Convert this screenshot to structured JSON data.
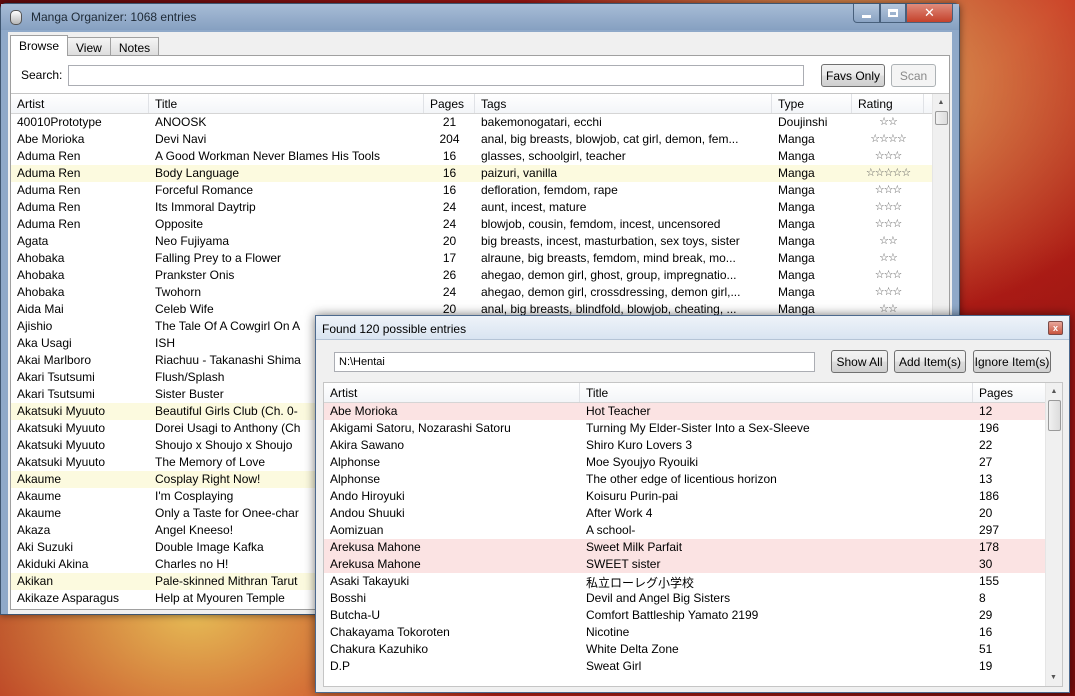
{
  "main_window": {
    "title": "Manga Organizer: 1068 entries",
    "tabs": [
      {
        "label": "Browse",
        "active": true
      },
      {
        "label": "View",
        "active": false
      },
      {
        "label": "Notes",
        "active": false
      }
    ],
    "search": {
      "label": "Search:",
      "value": ""
    },
    "buttons": {
      "favs_only": "Favs Only",
      "scan": "Scan"
    },
    "table": {
      "columns": [
        "Artist",
        "Title",
        "Pages",
        "Tags",
        "Type",
        "Rating"
      ],
      "rows": [
        {
          "artist": "40010Prototype",
          "title": "ANOOSK",
          "pages": "21",
          "tags": "bakemonogatari, ecchi",
          "type": "Doujinshi",
          "rating": "☆☆",
          "highlight": false
        },
        {
          "artist": "Abe Morioka",
          "title": "Devi Navi",
          "pages": "204",
          "tags": "anal, big breasts, blowjob, cat girl, demon, fem...",
          "type": "Manga",
          "rating": "☆☆☆☆",
          "highlight": false
        },
        {
          "artist": "Aduma Ren",
          "title": "A Good Workman Never Blames His Tools",
          "pages": "16",
          "tags": "glasses, schoolgirl, teacher",
          "type": "Manga",
          "rating": "☆☆☆",
          "highlight": false
        },
        {
          "artist": "Aduma Ren",
          "title": "Body Language",
          "pages": "16",
          "tags": "paizuri, vanilla",
          "type": "Manga",
          "rating": "☆☆☆☆☆",
          "highlight": true
        },
        {
          "artist": "Aduma Ren",
          "title": "Forceful Romance",
          "pages": "16",
          "tags": "defloration, femdom, rape",
          "type": "Manga",
          "rating": "☆☆☆",
          "highlight": false
        },
        {
          "artist": "Aduma Ren",
          "title": "Its Immoral Daytrip",
          "pages": "24",
          "tags": "aunt, incest, mature",
          "type": "Manga",
          "rating": "☆☆☆",
          "highlight": false
        },
        {
          "artist": "Aduma Ren",
          "title": "Opposite",
          "pages": "24",
          "tags": "blowjob, cousin, femdom, incest, uncensored",
          "type": "Manga",
          "rating": "☆☆☆",
          "highlight": false
        },
        {
          "artist": "Agata",
          "title": "Neo Fujiyama",
          "pages": "20",
          "tags": "big breasts, incest, masturbation, sex toys, sister",
          "type": "Manga",
          "rating": "☆☆",
          "highlight": false
        },
        {
          "artist": "Ahobaka",
          "title": "Falling Prey to a Flower",
          "pages": "17",
          "tags": "alraune, big breasts, femdom, mind break, mo...",
          "type": "Manga",
          "rating": "☆☆",
          "highlight": false
        },
        {
          "artist": "Ahobaka",
          "title": "Prankster Onis",
          "pages": "26",
          "tags": "ahegao, demon girl, ghost, group, impregnatio...",
          "type": "Manga",
          "rating": "☆☆☆",
          "highlight": false
        },
        {
          "artist": "Ahobaka",
          "title": "Twohorn",
          "pages": "24",
          "tags": "ahegao, demon girl, crossdressing, demon girl,...",
          "type": "Manga",
          "rating": "☆☆☆",
          "highlight": false
        },
        {
          "artist": "Aida Mai",
          "title": "Celeb Wife",
          "pages": "20",
          "tags": "anal, big breasts, blindfold, blowjob, cheating, ...",
          "type": "Manga",
          "rating": "☆☆",
          "highlight": false
        },
        {
          "artist": "Ajishio",
          "title": "The Tale Of A Cowgirl On A",
          "pages": "",
          "tags": "",
          "type": "",
          "rating": "",
          "highlight": false
        },
        {
          "artist": "Aka Usagi",
          "title": "ISH",
          "pages": "",
          "tags": "",
          "type": "",
          "rating": "",
          "highlight": false
        },
        {
          "artist": "Akai Marlboro",
          "title": "Riachuu - Takanashi Shima",
          "pages": "",
          "tags": "",
          "type": "",
          "rating": "",
          "highlight": false
        },
        {
          "artist": "Akari Tsutsumi",
          "title": "Flush/Splash",
          "pages": "",
          "tags": "",
          "type": "",
          "rating": "",
          "highlight": false
        },
        {
          "artist": "Akari Tsutsumi",
          "title": "Sister Buster",
          "pages": "",
          "tags": "",
          "type": "",
          "rating": "",
          "highlight": false
        },
        {
          "artist": "Akatsuki Myuuto",
          "title": "Beautiful Girls Club (Ch. 0-",
          "pages": "",
          "tags": "",
          "type": "",
          "rating": "",
          "highlight": true
        },
        {
          "artist": "Akatsuki Myuuto",
          "title": "Dorei Usagi to Anthony (Ch",
          "pages": "",
          "tags": "",
          "type": "",
          "rating": "",
          "highlight": false
        },
        {
          "artist": "Akatsuki Myuuto",
          "title": "Shoujo x Shoujo x Shoujo",
          "pages": "",
          "tags": "",
          "type": "",
          "rating": "",
          "highlight": false
        },
        {
          "artist": "Akatsuki Myuuto",
          "title": "The Memory of Love",
          "pages": "",
          "tags": "",
          "type": "",
          "rating": "",
          "highlight": false
        },
        {
          "artist": "Akaume",
          "title": "Cosplay Right Now!",
          "pages": "",
          "tags": "",
          "type": "",
          "rating": "",
          "highlight": true
        },
        {
          "artist": "Akaume",
          "title": "I'm Cosplaying",
          "pages": "",
          "tags": "",
          "type": "",
          "rating": "",
          "highlight": false
        },
        {
          "artist": "Akaume",
          "title": "Only a Taste for Onee-char",
          "pages": "",
          "tags": "",
          "type": "",
          "rating": "",
          "highlight": false
        },
        {
          "artist": "Akaza",
          "title": "Angel Kneeso!",
          "pages": "",
          "tags": "",
          "type": "",
          "rating": "",
          "highlight": false
        },
        {
          "artist": "Aki Suzuki",
          "title": "Double Image Kafka",
          "pages": "",
          "tags": "",
          "type": "",
          "rating": "",
          "highlight": false
        },
        {
          "artist": "Akiduki Akina",
          "title": "Charles no H!",
          "pages": "",
          "tags": "",
          "type": "",
          "rating": "",
          "highlight": false
        },
        {
          "artist": "Akikan",
          "title": "Pale-skinned Mithran Tarut",
          "pages": "",
          "tags": "",
          "type": "",
          "rating": "",
          "highlight": true
        },
        {
          "artist": "Akikaze Asparagus",
          "title": "Help at Myouren Temple",
          "pages": "",
          "tags": "",
          "type": "",
          "rating": "",
          "highlight": false
        }
      ]
    }
  },
  "dialog": {
    "title": "Found 120 possible entries",
    "close_glyph": "x",
    "path_value": "N:\\Hentai",
    "buttons": {
      "show_all": "Show All",
      "add_items": "Add Item(s)",
      "ignore_items": "Ignore Item(s)"
    },
    "table": {
      "columns": [
        "Artist",
        "Title",
        "Pages"
      ],
      "rows": [
        {
          "artist": "Abe Morioka",
          "title": "Hot Teacher",
          "pages": "12",
          "highlight": true
        },
        {
          "artist": "Akigami Satoru, Nozarashi Satoru",
          "title": "Turning My Elder-Sister Into a Sex-Sleeve",
          "pages": "196",
          "highlight": false
        },
        {
          "artist": "Akira Sawano",
          "title": "Shiro Kuro Lovers 3",
          "pages": "22",
          "highlight": false
        },
        {
          "artist": "Alphonse",
          "title": "Moe Syoujyo Ryouiki",
          "pages": "27",
          "highlight": false
        },
        {
          "artist": "Alphonse",
          "title": "The other edge of licentious horizon",
          "pages": "13",
          "highlight": false
        },
        {
          "artist": "Ando Hiroyuki",
          "title": "Koisuru Purin-pai",
          "pages": "186",
          "highlight": false
        },
        {
          "artist": "Andou Shuuki",
          "title": "After Work 4",
          "pages": "20",
          "highlight": false
        },
        {
          "artist": "Aomizuan",
          "title": "A school-",
          "pages": "297",
          "highlight": false
        },
        {
          "artist": "Arekusa Mahone",
          "title": "Sweet Milk Parfait",
          "pages": "178",
          "highlight": true
        },
        {
          "artist": "Arekusa Mahone",
          "title": "SWEET sister",
          "pages": "30",
          "highlight": true
        },
        {
          "artist": "Asaki Takayuki",
          "title": "私立ローレグ小学校",
          "pages": "155",
          "highlight": false
        },
        {
          "artist": "Bosshi",
          "title": "Devil and Angel Big Sisters",
          "pages": "8",
          "highlight": false
        },
        {
          "artist": "Butcha-U",
          "title": "Comfort Battleship Yamato 2199",
          "pages": "29",
          "highlight": false
        },
        {
          "artist": "Chakayama Tokoroten",
          "title": "Nicotine",
          "pages": "16",
          "highlight": false
        },
        {
          "artist": "Chakura Kazuhiko",
          "title": "White Delta Zone",
          "pages": "51",
          "highlight": false
        },
        {
          "artist": "D.P",
          "title": "Sweat Girl",
          "pages": "19",
          "highlight": false
        }
      ]
    }
  }
}
